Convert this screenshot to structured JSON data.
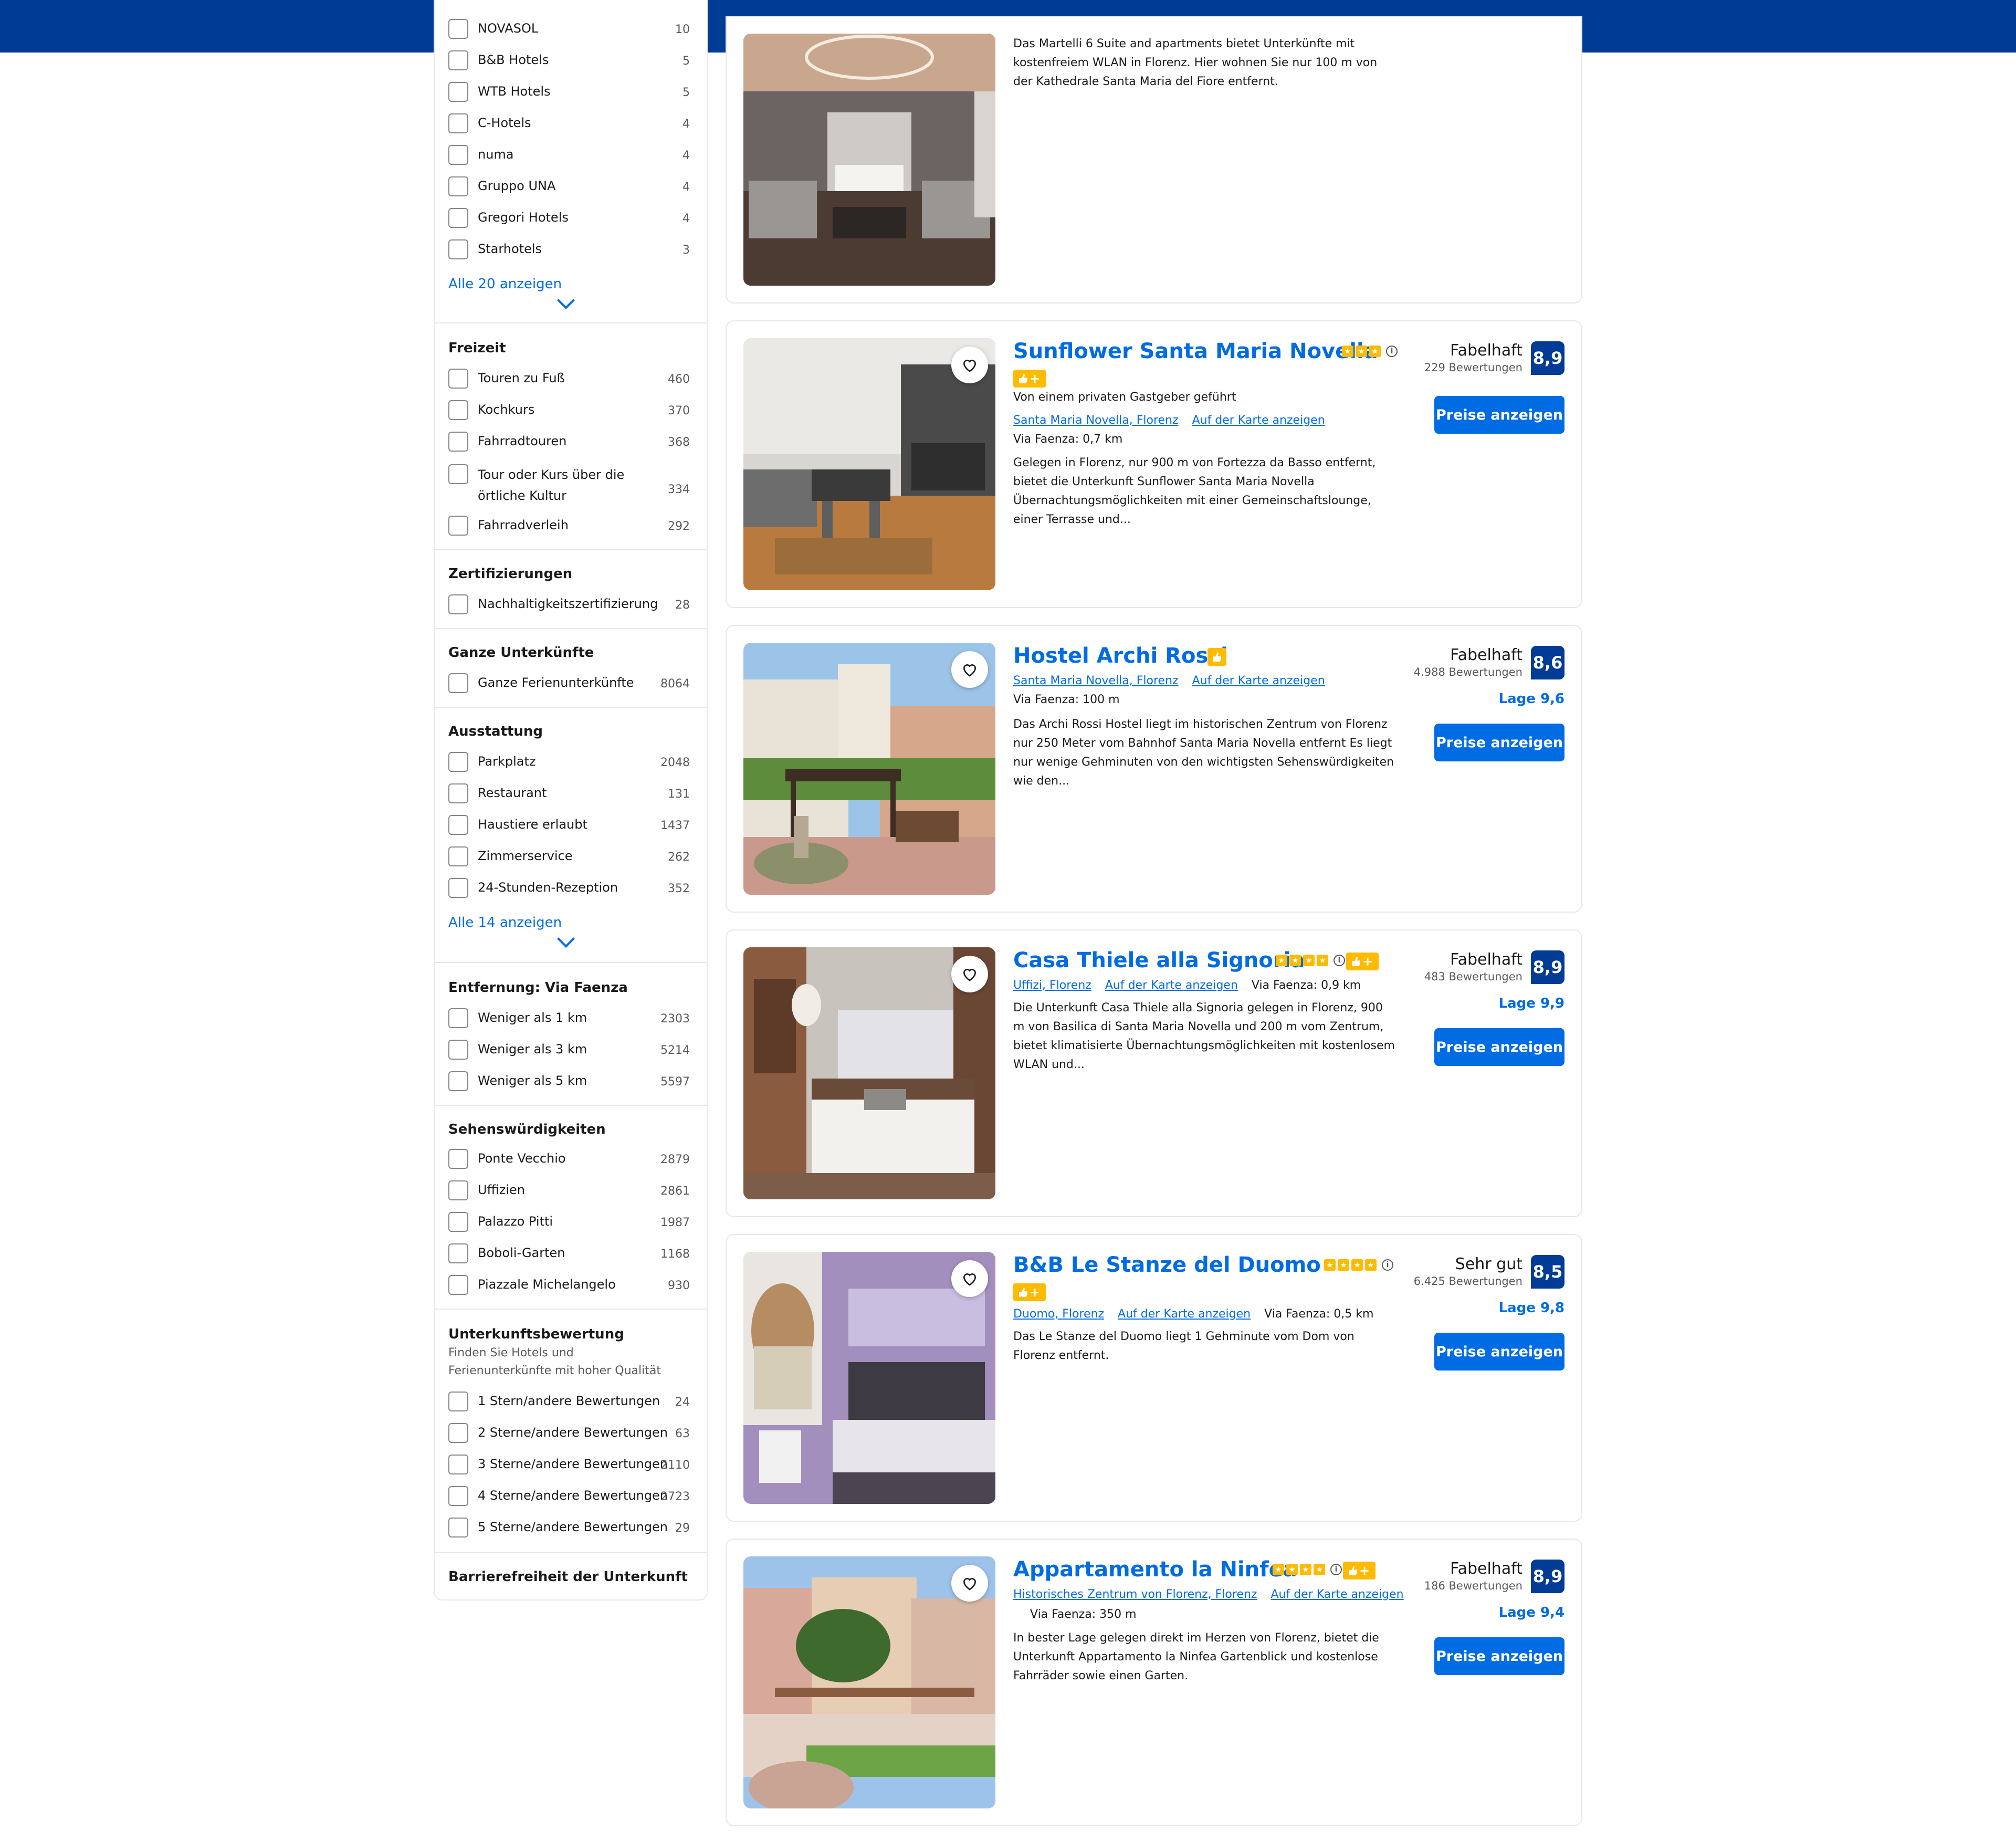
{
  "colors": {
    "header": "#003b95",
    "link": "#006ce4",
    "score": "#003b95",
    "star": "#febb02",
    "button": "#006ce4"
  },
  "filters": {
    "chains": [
      {
        "label": "NOVASOL",
        "count": "10"
      },
      {
        "label": "B&B Hotels",
        "count": "5"
      },
      {
        "label": "WTB Hotels",
        "count": "5"
      },
      {
        "label": "C-Hotels",
        "count": "4"
      },
      {
        "label": "numa",
        "count": "4"
      },
      {
        "label": "Gruppo UNA",
        "count": "4"
      },
      {
        "label": "Gregori Hotels",
        "count": "4"
      },
      {
        "label": "Starhotels",
        "count": "3"
      }
    ],
    "chains_show_all": "Alle 20 anzeigen",
    "freizeit": {
      "title": "Freizeit",
      "items": [
        {
          "label": "Touren zu Fuß",
          "count": "460"
        },
        {
          "label": "Kochkurs",
          "count": "370"
        },
        {
          "label": "Fahrradtouren",
          "count": "368"
        },
        {
          "label": "Tour oder Kurs über die örtliche Kultur",
          "count": "334"
        },
        {
          "label": "Fahrradverleih",
          "count": "292"
        }
      ]
    },
    "zertifizierungen": {
      "title": "Zertifizierungen",
      "items": [
        {
          "label": "Nachhaltigkeitszertifizierung",
          "count": "28"
        }
      ]
    },
    "ganze": {
      "title": "Ganze Unterkünfte",
      "items": [
        {
          "label": "Ganze Ferienunterkünfte",
          "count": "8064"
        }
      ]
    },
    "ausstattung": {
      "title": "Ausstattung",
      "items": [
        {
          "label": "Parkplatz",
          "count": "2048"
        },
        {
          "label": "Restaurant",
          "count": "131"
        },
        {
          "label": "Haustiere erlaubt",
          "count": "1437"
        },
        {
          "label": "Zimmerservice",
          "count": "262"
        },
        {
          "label": "24-Stunden-Rezeption",
          "count": "352"
        }
      ],
      "show_all": "Alle 14 anzeigen"
    },
    "entfernung": {
      "title": "Entfernung: Via Faenza",
      "items": [
        {
          "label": "Weniger als 1 km",
          "count": "2303"
        },
        {
          "label": "Weniger als 3 km",
          "count": "5214"
        },
        {
          "label": "Weniger als 5 km",
          "count": "5597"
        }
      ]
    },
    "sehens": {
      "title": "Sehenswürdigkeiten",
      "items": [
        {
          "label": "Ponte Vecchio",
          "count": "2879"
        },
        {
          "label": "Uffizien",
          "count": "2861"
        },
        {
          "label": "Palazzo Pitti",
          "count": "1987"
        },
        {
          "label": "Boboli-Garten",
          "count": "1168"
        },
        {
          "label": "Piazzale Michelangelo",
          "count": "930"
        }
      ]
    },
    "bewertung": {
      "title": "Unterkunftsbewertung",
      "subtitle": "Finden Sie Hotels und Ferienunterkünfte mit hoher Qualität",
      "items": [
        {
          "label": "1 Stern/andere Bewertungen",
          "count": "24"
        },
        {
          "label": "2 Sterne/andere Bewertungen",
          "count": "63"
        },
        {
          "label": "3 Sterne/andere Bewertungen",
          "count": "2110"
        },
        {
          "label": "4 Sterne/andere Bewertungen",
          "count": "2723"
        },
        {
          "label": "5 Sterne/andere Bewertungen",
          "count": "29"
        }
      ]
    },
    "barriere": {
      "title": "Barrierefreiheit der Unterkunft"
    }
  },
  "listings": [
    {
      "description": "Das Martelli 6 Suite and apartments bietet Unterkünfte mit kostenfreiem WLAN in Florenz. Hier wohnen Sie nur 100 m von der Kathedrale Santa Maria del Fiore entfernt."
    },
    {
      "name": "Sunflower Santa Maria Novella",
      "stars": 3,
      "host": "Von einem privaten Gastgeber geführt",
      "area": "Santa Maria Novella, Florenz",
      "map_link": "Auf der Karte anzeigen",
      "distance": "Via Faenza: 0,7 km",
      "description": "Gelegen in Florenz, nur 900 m von Fortezza da Basso entfernt, bietet die Unterkunft Sunflower Santa Maria Novella Übernachtungsmöglichkeiten mit einer Gemeinschaftslounge, einer Terrasse und...",
      "rating_word": "Fabelhaft",
      "reviews": "229 Bewertungen",
      "score": "8,9",
      "button": "Preise anzeigen"
    },
    {
      "name": "Hostel Archi Rossi",
      "area": "Santa Maria Novella, Florenz",
      "map_link": "Auf der Karte anzeigen",
      "distance": "Via Faenza: 100 m",
      "description": "Das Archi Rossi Hostel liegt im historischen Zentrum von Florenz nur 250 Meter vom Bahnhof Santa Maria Novella entfernt Es liegt nur wenige Gehminuten von den wichtigsten Sehenswürdigkeiten wie den...",
      "rating_word": "Fabelhaft",
      "reviews": "4.988 Bewertungen",
      "score": "8,6",
      "lage": "Lage 9,6",
      "button": "Preise anzeigen"
    },
    {
      "name": "Casa Thiele alla Signoria",
      "stars": 4,
      "area": "Uffizi, Florenz",
      "map_link": "Auf der Karte anzeigen",
      "distance": "Via Faenza: 0,9 km",
      "description": "Die Unterkunft Casa Thiele alla Signoria gelegen in Florenz, 900 m von Basilica di Santa Maria Novella und 200 m vom Zentrum, bietet klimatisierte Übernachtungsmöglichkeiten mit kostenlosem WLAN und...",
      "rating_word": "Fabelhaft",
      "reviews": "483 Bewertungen",
      "score": "8,9",
      "lage": "Lage 9,9",
      "button": "Preise anzeigen"
    },
    {
      "name": "B&B Le Stanze del Duomo",
      "stars": 4,
      "area": "Duomo, Florenz",
      "map_link": "Auf der Karte anzeigen",
      "distance": "Via Faenza: 0,5 km",
      "description": "Das Le Stanze del Duomo liegt 1 Gehminute vom Dom von Florenz entfernt.",
      "rating_word": "Sehr gut",
      "reviews": "6.425 Bewertungen",
      "score": "8,5",
      "lage": "Lage 9,8",
      "button": "Preise anzeigen"
    },
    {
      "name": "Appartamento la Ninfea",
      "stars": 4,
      "area": "Historisches Zentrum von Florenz, Florenz",
      "map_link": "Auf der Karte anzeigen",
      "distance": "Via Faenza: 350 m",
      "description": "In bester Lage gelegen direkt im Herzen von Florenz, bietet die Unterkunft Appartamento la Ninfea Gartenblick und kostenlose Fahrräder sowie einen Garten.",
      "rating_word": "Fabelhaft",
      "reviews": "186 Bewertungen",
      "score": "8,9",
      "lage": "Lage 9,4",
      "button": "Preise anzeigen"
    }
  ]
}
